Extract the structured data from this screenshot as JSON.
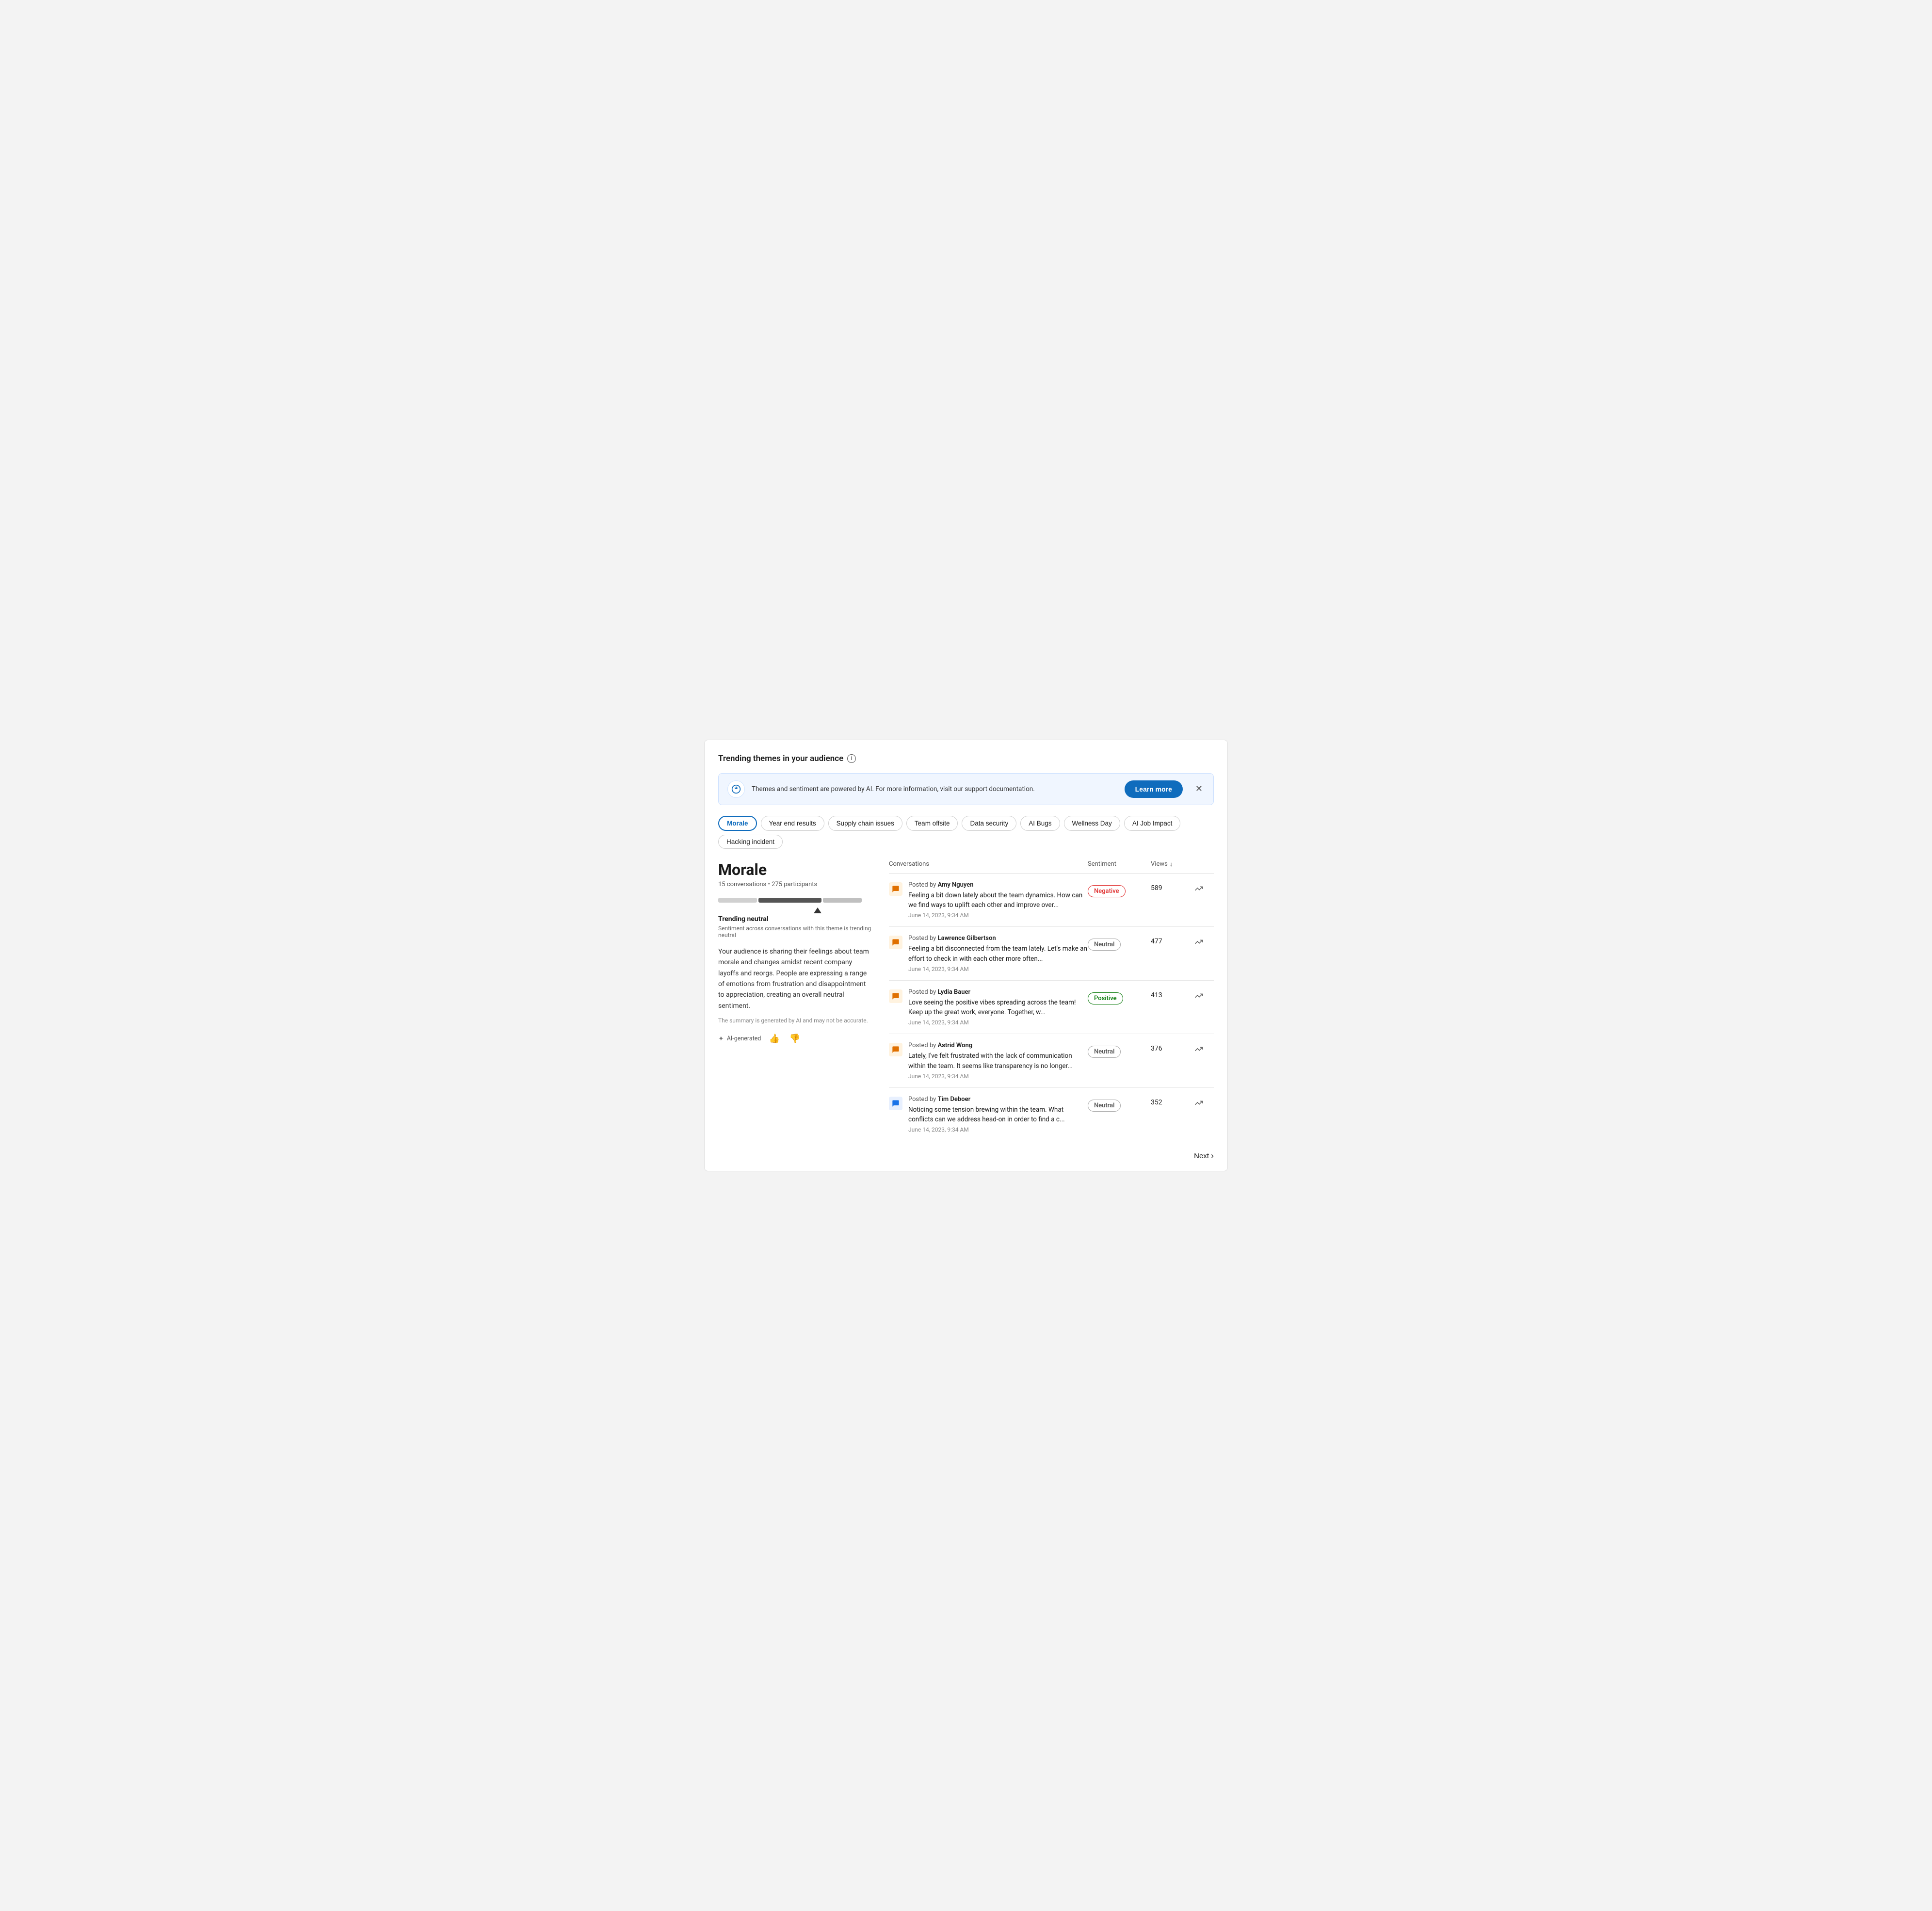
{
  "page": {
    "title": "Trending themes in your audience"
  },
  "banner": {
    "text": "Themes and sentiment are powered by AI. For more information, visit our support documentation.",
    "learn_more": "Learn more"
  },
  "tags": [
    {
      "id": "morale",
      "label": "Morale",
      "active": true
    },
    {
      "id": "year-end-results",
      "label": "Year end results",
      "active": false
    },
    {
      "id": "supply-chain-issues",
      "label": "Supply chain issues",
      "active": false
    },
    {
      "id": "team-offsite",
      "label": "Team offsite",
      "active": false
    },
    {
      "id": "data-security",
      "label": "Data security",
      "active": false
    },
    {
      "id": "ai-bugs",
      "label": "AI Bugs",
      "active": false
    },
    {
      "id": "wellness-day",
      "label": "Wellness Day",
      "active": false
    },
    {
      "id": "ai-job-impact",
      "label": "AI Job Impact",
      "active": false
    },
    {
      "id": "hacking-incident",
      "label": "Hacking incident",
      "active": false
    }
  ],
  "theme": {
    "name": "Morale",
    "conversations_count": "15 conversations",
    "participants_count": "275 participants",
    "trending_label": "Trending neutral",
    "trending_sublabel": "Sentiment across conversations with this theme is trending neutral",
    "summary": "Your audience is sharing their feelings about team morale and changes amidst recent company layoffs and reorgs. People are expressing a range of emotions from frustration and disappointment to appreciation, creating an overall neutral sentiment.",
    "ai_disclaimer": "The summary is generated by AI and may not be accurate.",
    "ai_badge_label": "AI-generated"
  },
  "table": {
    "col_conversations": "Conversations",
    "col_sentiment": "Sentiment",
    "col_views": "Views",
    "rows": [
      {
        "author": "Amy Nguyen",
        "text": "Feeling a bit down lately about the team dynamics. How can we find ways to uplift each other and improve over...",
        "date": "June 14, 2023, 9:34 AM",
        "sentiment": "Negative",
        "sentiment_type": "negative",
        "views": "589",
        "icon_color": "orange"
      },
      {
        "author": "Lawrence Gilbertson",
        "text": "Feeling a bit disconnected from the team lately. Let's make an effort to check in with each other more often...",
        "date": "June 14, 2023, 9:34 AM",
        "sentiment": "Neutral",
        "sentiment_type": "neutral",
        "views": "477",
        "icon_color": "orange"
      },
      {
        "author": "Lydia Bauer",
        "text": "Love seeing the positive vibes spreading across the team! Keep up the great work, everyone. Together, w...",
        "date": "June 14, 2023, 9:34 AM",
        "sentiment": "Positive",
        "sentiment_type": "positive",
        "views": "413",
        "icon_color": "orange"
      },
      {
        "author": "Astrid Wong",
        "text": "Lately, I've felt frustrated with the lack of communication within the team. It seems like transparency is no longer...",
        "date": "June 14, 2023, 9:34 AM",
        "sentiment": "Neutral",
        "sentiment_type": "neutral",
        "views": "376",
        "icon_color": "orange"
      },
      {
        "author": "Tim Deboer",
        "text": "Noticing some tension brewing within the team. What conflicts can we address head-on in order to find a c...",
        "date": "June 14, 2023, 9:34 AM",
        "sentiment": "Neutral",
        "sentiment_type": "neutral",
        "views": "352",
        "icon_color": "blue"
      }
    ]
  },
  "pagination": {
    "next_label": "Next"
  }
}
